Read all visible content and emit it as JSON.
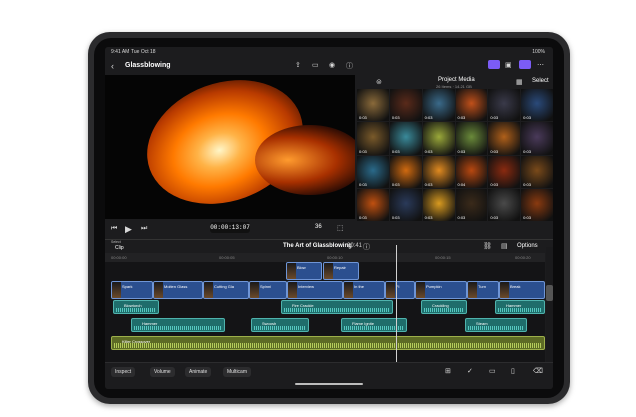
{
  "status": {
    "time": "9:41 AM",
    "date": "Tue Oct 18",
    "battery": "100%"
  },
  "titlebar": {
    "back_icon": "chevron-left-icon",
    "title": "Glassblowing",
    "icons": [
      "share-icon",
      "camera-icon",
      "voiceover-icon",
      "info-icon"
    ],
    "right_icons": [
      "photos-view-icon",
      "browser-icon",
      "inspector-icon",
      "more-icon"
    ]
  },
  "viewer": {
    "timecode": "00:00:13:07",
    "zoom": "36"
  },
  "browser": {
    "title": "Project Media",
    "subtitle": "26 Items · 14.21 GB",
    "select_label": "Select",
    "thumbs": [
      {
        "dur": "0:03",
        "color": "#8a6a3a"
      },
      {
        "dur": "0:03",
        "color": "#5a2a1a"
      },
      {
        "dur": "0:03",
        "color": "#3a6a8a"
      },
      {
        "dur": "0:03",
        "color": "#c0501a"
      },
      {
        "dur": "0:03",
        "color": "#3a3a4a"
      },
      {
        "dur": "0:03",
        "color": "#2a4a7a"
      },
      {
        "dur": "0:03",
        "color": "#7a5a2a"
      },
      {
        "dur": "0:03",
        "color": "#3a8a9a"
      },
      {
        "dur": "0:03",
        "color": "#9aa83a"
      },
      {
        "dur": "0:03",
        "color": "#6a8a3a"
      },
      {
        "dur": "0:03",
        "color": "#b0601a"
      },
      {
        "dur": "0:03",
        "color": "#4a3a5a"
      },
      {
        "dur": "0:03",
        "color": "#2a6a8a"
      },
      {
        "dur": "0:03",
        "color": "#d06a10"
      },
      {
        "dur": "0:03",
        "color": "#e08a20"
      },
      {
        "dur": "0:04",
        "color": "#b84810"
      },
      {
        "dur": "0:03",
        "color": "#8a2a10"
      },
      {
        "dur": "0:03",
        "color": "#7a4a1a"
      },
      {
        "dur": "0:03",
        "color": "#c05010"
      },
      {
        "dur": "0:03",
        "color": "#2a3a5a"
      },
      {
        "dur": "0:03",
        "color": "#d89a20"
      },
      {
        "dur": "0:03",
        "color": "#3a2a1a"
      },
      {
        "dur": "0:03",
        "color": "#4a4a4a"
      },
      {
        "dur": "0:03",
        "color": "#8a3a10"
      }
    ]
  },
  "project": {
    "select_label": "Select",
    "clip_label": "Clip",
    "name": "The Art of Glassblowing",
    "duration": "00:41",
    "options_label": "Options"
  },
  "ruler": [
    "00:00:00",
    "00:00:05",
    "00:00:10",
    "00:00:15",
    "00:00:20"
  ],
  "clips": {
    "connected": [
      {
        "label": "Blow"
      },
      {
        "label": "Repair"
      }
    ],
    "primary": [
      {
        "label": "Spark"
      },
      {
        "label": "Molten Glass"
      },
      {
        "label": "Cutting Gla"
      },
      {
        "label": "Spinni"
      },
      {
        "label": "Interview"
      },
      {
        "label": "In the"
      },
      {
        "label": "Fi"
      },
      {
        "label": "Pumpkin"
      },
      {
        "label": "Turn"
      },
      {
        "label": "Break"
      }
    ],
    "audio1": [
      {
        "label": "Blowtorch"
      },
      {
        "label": "Fire Crackle"
      },
      {
        "label": "Crackling"
      },
      {
        "label": "Hammer"
      }
    ],
    "audio2": [
      {
        "label": "Hammer"
      },
      {
        "label": "Swoosh"
      },
      {
        "label": "Flame Ignite"
      },
      {
        "label": "Steam"
      }
    ],
    "music": {
      "label": "Killer Crossover"
    }
  },
  "bottom": {
    "inspect": "Inspect",
    "volume": "Volume",
    "animate": "Animate",
    "multicam": "Multicam"
  }
}
